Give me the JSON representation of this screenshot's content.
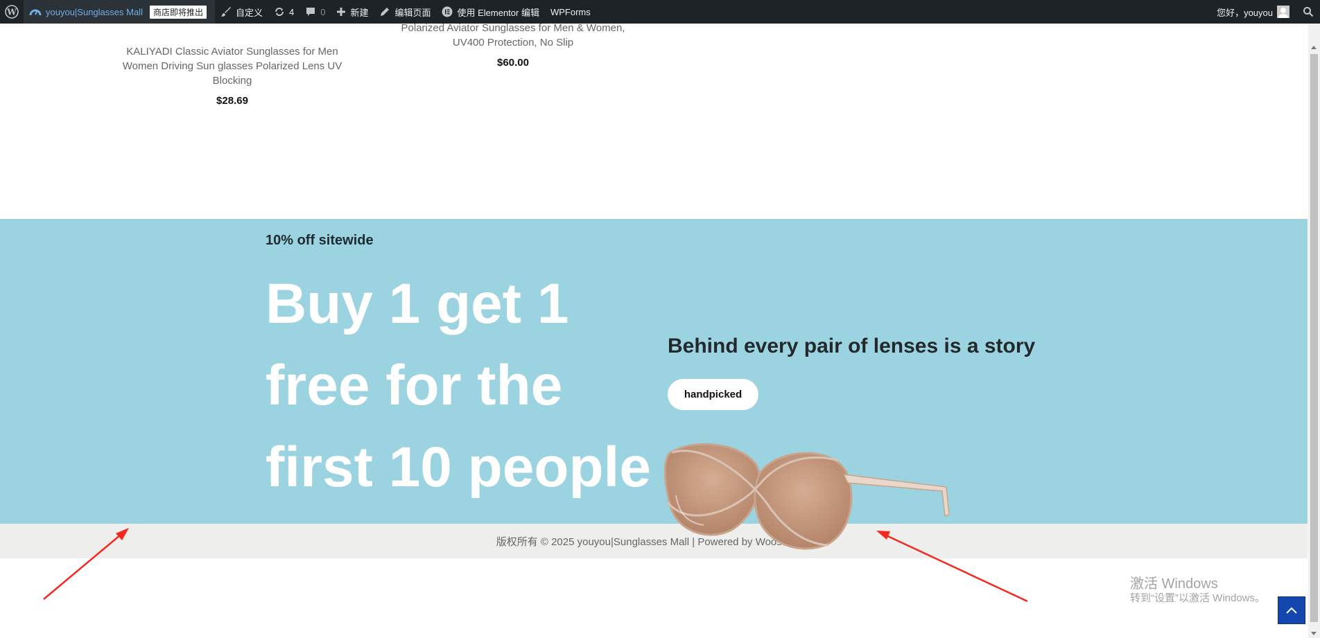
{
  "adminbar": {
    "site_name": "youyou|Sunglasses Mall",
    "badge": "商店即将推出",
    "customize": "自定义",
    "updates_count": "4",
    "comments_count": "0",
    "new": "新建",
    "edit_page": "编辑页面",
    "elementor": "使用 Elementor 编辑",
    "wpforms": "WPForms",
    "greeting": "您好，youyou"
  },
  "products": [
    {
      "title": "KALIYADI Classic Aviator Sunglasses for Men Women Driving Sun glasses Polarized Lens UV Blocking",
      "price": "$28.69"
    },
    {
      "title": "Polarized Aviator Sunglasses for Men & Women, UV400 Protection, No Slip",
      "price": "$60.00"
    }
  ],
  "promo": {
    "subtitle": "10% off sitewide",
    "headline": "Buy 1 get 1 free for the first 10 people",
    "story": "Behind every pair of lenses is a story",
    "button": "handpicked"
  },
  "footer": {
    "copyright": "版权所有 © 2025 youyou|Sunglasses Mall | Powered by WoostifyPro"
  },
  "watermark": {
    "line1": "激活 Windows",
    "line2": "转到“设置”以激活 Windows。"
  },
  "colors": {
    "promo_bg": "#9bd4e0",
    "adminbar_bg": "#1d2327",
    "site_link": "#72aee6",
    "annotation_arrow": "#f5281e",
    "totop_bg": "#1346af"
  }
}
